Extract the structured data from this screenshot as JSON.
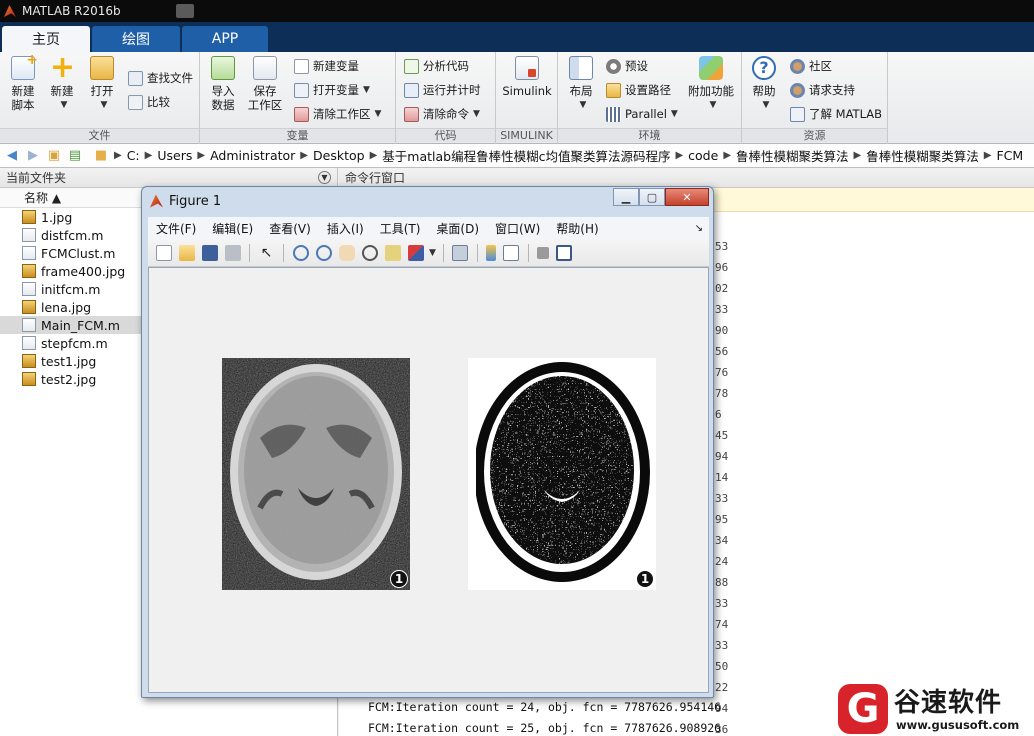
{
  "app": {
    "title": "MATLAB R2016b"
  },
  "tabs": [
    {
      "label": "主页",
      "active": true
    },
    {
      "label": "绘图",
      "active": false
    },
    {
      "label": "APP",
      "active": false
    }
  ],
  "ribbon": {
    "file": {
      "group_label": "文件",
      "new_script": "新建\n脚本",
      "new": "新建",
      "open": "打开",
      "find_files": "查找文件",
      "compare": "比较"
    },
    "variable": {
      "group_label": "变量",
      "import_data": "导入\n数据",
      "save_workspace": "保存\n工作区",
      "new_variable": "新建变量",
      "open_variable": "打开变量",
      "clear_workspace": "清除工作区"
    },
    "code": {
      "group_label": "代码",
      "analyze_code": "分析代码",
      "run_and_time": "运行并计时",
      "clear_commands": "清除命令"
    },
    "simulink": {
      "group_label": "SIMULINK",
      "simulink": "Simulink"
    },
    "environment": {
      "group_label": "环境",
      "layout": "布局",
      "preferences": "预设",
      "set_path": "设置路径",
      "parallel": "Parallel",
      "addons": "附加功能"
    },
    "resources": {
      "group_label": "资源",
      "help": "帮助",
      "community": "社区",
      "request_support": "请求支持",
      "learn_matlab": "了解 MATLAB"
    }
  },
  "address": {
    "crumbs": [
      "C:",
      "Users",
      "Administrator",
      "Desktop",
      "基于matlab编程鲁棒性模糊c均值聚类算法源码程序",
      "code",
      "鲁棒性模糊聚类算法",
      "鲁棒性模糊聚类算法",
      "FCM"
    ]
  },
  "current_folder": {
    "title": "当前文件夹",
    "column_name": "名称 ▲",
    "files": [
      {
        "name": "1.jpg",
        "type": "jpg",
        "selected": false
      },
      {
        "name": "distfcm.m",
        "type": "m",
        "selected": false
      },
      {
        "name": "FCMClust.m",
        "type": "m",
        "selected": false
      },
      {
        "name": "frame400.jpg",
        "type": "jpg",
        "selected": false
      },
      {
        "name": "initfcm.m",
        "type": "m",
        "selected": false
      },
      {
        "name": "lena.jpg",
        "type": "jpg",
        "selected": false
      },
      {
        "name": "Main_FCM.m",
        "type": "m",
        "selected": true
      },
      {
        "name": "stepfcm.m",
        "type": "m",
        "selected": false
      },
      {
        "name": "test1.jpg",
        "type": "jpg",
        "selected": false
      },
      {
        "name": "test2.jpg",
        "type": "jpg",
        "selected": false
      }
    ]
  },
  "command_window": {
    "title": "命令行窗口",
    "partial_digits": [
      "53",
      "96",
      "02",
      "33",
      "90",
      "56",
      "76",
      "78",
      "6",
      "45",
      "94",
      "14",
      "33",
      "95",
      "34",
      "24",
      "88",
      "33",
      "74",
      "33",
      "50",
      "22",
      "94",
      "36"
    ],
    "lines": [
      "FCM:Iteration count = 24, obj. fcn = 7787626.954146",
      "FCM:Iteration count = 25, obj. fcn = 7787626.908926"
    ]
  },
  "figure": {
    "title": "Figure 1",
    "menu": [
      "文件(F)",
      "编辑(E)",
      "查看(V)",
      "插入(I)",
      "工具(T)",
      "桌面(D)",
      "窗口(W)",
      "帮助(H)"
    ],
    "badge_left": "1",
    "badge_right": "1"
  },
  "watermark": {
    "glyph": "G",
    "name": "谷速软件",
    "url": "www.gususoft.com"
  },
  "colors": {
    "tabbar": "#0d2f57",
    "tab_inactive": "#1e5fa7",
    "selected_row": "#d9d9d9"
  }
}
